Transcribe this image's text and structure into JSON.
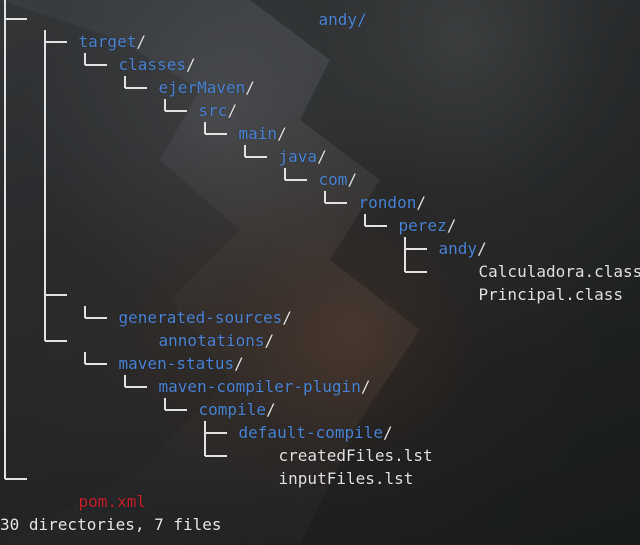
{
  "terminal": {
    "truncated_top": "andy/",
    "entries": [
      {
        "name": "target",
        "suffix": "/",
        "kind": "dir"
      },
      {
        "name": "classes",
        "suffix": "/",
        "kind": "dir"
      },
      {
        "name": "ejerMaven",
        "suffix": "/",
        "kind": "dir"
      },
      {
        "name": "src",
        "suffix": "/",
        "kind": "dir"
      },
      {
        "name": "main",
        "suffix": "/",
        "kind": "dir"
      },
      {
        "name": "java",
        "suffix": "/",
        "kind": "dir"
      },
      {
        "name": "com",
        "suffix": "/",
        "kind": "dir"
      },
      {
        "name": "rondon",
        "suffix": "/",
        "kind": "dir"
      },
      {
        "name": "perez",
        "suffix": "/",
        "kind": "dir"
      },
      {
        "name": "andy",
        "suffix": "/",
        "kind": "dir"
      },
      {
        "name": "Calculadora.class",
        "suffix": "",
        "kind": "file"
      },
      {
        "name": "Principal.class",
        "suffix": "",
        "kind": "file"
      },
      {
        "name": "generated-sources",
        "suffix": "/",
        "kind": "dir"
      },
      {
        "name": "annotations",
        "suffix": "/",
        "kind": "dir"
      },
      {
        "name": "maven-status",
        "suffix": "/",
        "kind": "dir"
      },
      {
        "name": "maven-compiler-plugin",
        "suffix": "/",
        "kind": "dir"
      },
      {
        "name": "compile",
        "suffix": "/",
        "kind": "dir"
      },
      {
        "name": "default-compile",
        "suffix": "/",
        "kind": "dir"
      },
      {
        "name": "createdFiles.lst",
        "suffix": "",
        "kind": "file"
      },
      {
        "name": "inputFiles.lst",
        "suffix": "",
        "kind": "file"
      },
      {
        "name": "pom.xml",
        "suffix": "",
        "kind": "special"
      }
    ],
    "summary": "30 directories, 7 files"
  },
  "colors": {
    "directory": "#4a84d6",
    "file": "#e2e2e2",
    "special_file": "#c8202a",
    "tree_lines": "#e2e2e2"
  }
}
